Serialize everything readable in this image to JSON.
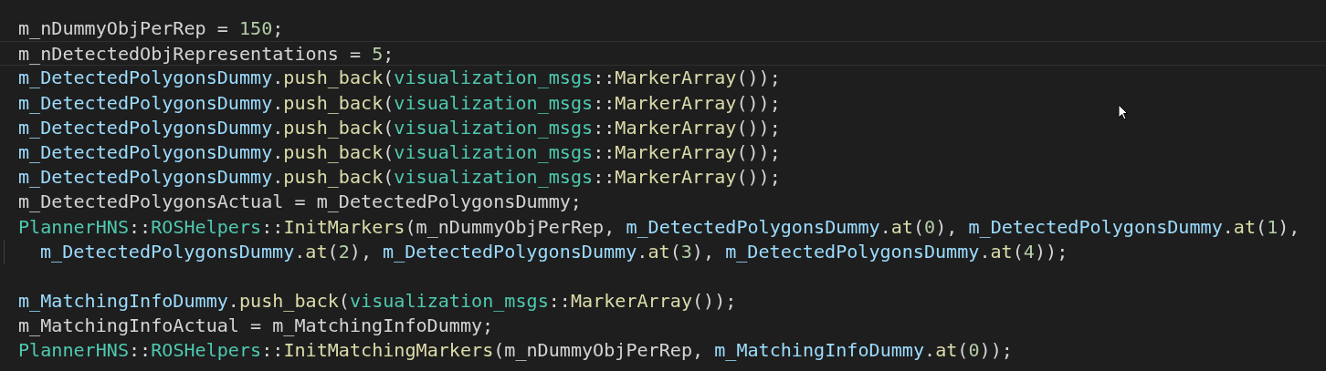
{
  "editor": {
    "lines": [
      {
        "kind": "code",
        "current": false,
        "tokens": [
          {
            "text": "m_nDummyObjPerRep = ",
            "kind": "plain"
          },
          {
            "text": "150",
            "kind": "number"
          },
          {
            "text": ";",
            "kind": "plain"
          }
        ]
      },
      {
        "kind": "code",
        "current": true,
        "tokens": [
          {
            "text": "m_nDetectedObjRepresentations = ",
            "kind": "plain"
          },
          {
            "text": "5",
            "kind": "number"
          },
          {
            "text": ";",
            "kind": "plain"
          }
        ]
      },
      {
        "kind": "code",
        "current": false,
        "tokens": [
          {
            "text": "m_DetectedPolygonsDummy",
            "kind": "variable"
          },
          {
            "text": ".",
            "kind": "plain"
          },
          {
            "text": "push_back",
            "kind": "function"
          },
          {
            "text": "(",
            "kind": "plain"
          },
          {
            "text": "visualization_msgs",
            "kind": "type"
          },
          {
            "text": "::",
            "kind": "plain"
          },
          {
            "text": "MarkerArray",
            "kind": "function"
          },
          {
            "text": "());",
            "kind": "plain"
          }
        ]
      },
      {
        "kind": "code",
        "current": false,
        "tokens": [
          {
            "text": "m_DetectedPolygonsDummy",
            "kind": "variable"
          },
          {
            "text": ".",
            "kind": "plain"
          },
          {
            "text": "push_back",
            "kind": "function"
          },
          {
            "text": "(",
            "kind": "plain"
          },
          {
            "text": "visualization_msgs",
            "kind": "type"
          },
          {
            "text": "::",
            "kind": "plain"
          },
          {
            "text": "MarkerArray",
            "kind": "function"
          },
          {
            "text": "());",
            "kind": "plain"
          }
        ]
      },
      {
        "kind": "code",
        "current": false,
        "tokens": [
          {
            "text": "m_DetectedPolygonsDummy",
            "kind": "variable"
          },
          {
            "text": ".",
            "kind": "plain"
          },
          {
            "text": "push_back",
            "kind": "function"
          },
          {
            "text": "(",
            "kind": "plain"
          },
          {
            "text": "visualization_msgs",
            "kind": "type"
          },
          {
            "text": "::",
            "kind": "plain"
          },
          {
            "text": "MarkerArray",
            "kind": "function"
          },
          {
            "text": "());",
            "kind": "plain"
          }
        ]
      },
      {
        "kind": "code",
        "current": false,
        "tokens": [
          {
            "text": "m_DetectedPolygonsDummy",
            "kind": "variable"
          },
          {
            "text": ".",
            "kind": "plain"
          },
          {
            "text": "push_back",
            "kind": "function"
          },
          {
            "text": "(",
            "kind": "plain"
          },
          {
            "text": "visualization_msgs",
            "kind": "type"
          },
          {
            "text": "::",
            "kind": "plain"
          },
          {
            "text": "MarkerArray",
            "kind": "function"
          },
          {
            "text": "());",
            "kind": "plain"
          }
        ]
      },
      {
        "kind": "code",
        "current": false,
        "tokens": [
          {
            "text": "m_DetectedPolygonsDummy",
            "kind": "variable"
          },
          {
            "text": ".",
            "kind": "plain"
          },
          {
            "text": "push_back",
            "kind": "function"
          },
          {
            "text": "(",
            "kind": "plain"
          },
          {
            "text": "visualization_msgs",
            "kind": "type"
          },
          {
            "text": "::",
            "kind": "plain"
          },
          {
            "text": "MarkerArray",
            "kind": "function"
          },
          {
            "text": "());",
            "kind": "plain"
          }
        ]
      },
      {
        "kind": "code",
        "current": false,
        "tokens": [
          {
            "text": "m_DetectedPolygonsActual = m_DetectedPolygonsDummy;",
            "kind": "plain"
          }
        ]
      },
      {
        "kind": "code",
        "current": false,
        "tokens": [
          {
            "text": "PlannerHNS",
            "kind": "type"
          },
          {
            "text": "::",
            "kind": "plain"
          },
          {
            "text": "ROSHelpers",
            "kind": "type"
          },
          {
            "text": "::",
            "kind": "plain"
          },
          {
            "text": "InitMarkers",
            "kind": "function"
          },
          {
            "text": "(m_nDummyObjPerRep, ",
            "kind": "plain"
          },
          {
            "text": "m_DetectedPolygonsDummy",
            "kind": "variable"
          },
          {
            "text": ".",
            "kind": "plain"
          },
          {
            "text": "at",
            "kind": "function"
          },
          {
            "text": "(",
            "kind": "plain"
          },
          {
            "text": "0",
            "kind": "number"
          },
          {
            "text": "), ",
            "kind": "plain"
          },
          {
            "text": "m_DetectedPolygonsDummy",
            "kind": "variable"
          },
          {
            "text": ".",
            "kind": "plain"
          },
          {
            "text": "at",
            "kind": "function"
          },
          {
            "text": "(",
            "kind": "plain"
          },
          {
            "text": "1",
            "kind": "number"
          },
          {
            "text": "),",
            "kind": "plain"
          }
        ]
      },
      {
        "kind": "continuation",
        "current": false,
        "tokens": [
          {
            "text": "m_DetectedPolygonsDummy",
            "kind": "variable"
          },
          {
            "text": ".",
            "kind": "plain"
          },
          {
            "text": "at",
            "kind": "function"
          },
          {
            "text": "(",
            "kind": "plain"
          },
          {
            "text": "2",
            "kind": "number"
          },
          {
            "text": "), ",
            "kind": "plain"
          },
          {
            "text": "m_DetectedPolygonsDummy",
            "kind": "variable"
          },
          {
            "text": ".",
            "kind": "plain"
          },
          {
            "text": "at",
            "kind": "function"
          },
          {
            "text": "(",
            "kind": "plain"
          },
          {
            "text": "3",
            "kind": "number"
          },
          {
            "text": "), ",
            "kind": "plain"
          },
          {
            "text": "m_DetectedPolygonsDummy",
            "kind": "variable"
          },
          {
            "text": ".",
            "kind": "plain"
          },
          {
            "text": "at",
            "kind": "function"
          },
          {
            "text": "(",
            "kind": "plain"
          },
          {
            "text": "4",
            "kind": "number"
          },
          {
            "text": "));",
            "kind": "plain"
          }
        ]
      },
      {
        "kind": "blank",
        "current": false
      },
      {
        "kind": "code",
        "current": false,
        "tokens": [
          {
            "text": "m_MatchingInfoDummy",
            "kind": "variable"
          },
          {
            "text": ".",
            "kind": "plain"
          },
          {
            "text": "push_back",
            "kind": "function"
          },
          {
            "text": "(",
            "kind": "plain"
          },
          {
            "text": "visualization_msgs",
            "kind": "type"
          },
          {
            "text": "::",
            "kind": "plain"
          },
          {
            "text": "MarkerArray",
            "kind": "function"
          },
          {
            "text": "());",
            "kind": "plain"
          }
        ]
      },
      {
        "kind": "code",
        "current": false,
        "tokens": [
          {
            "text": "m_MatchingInfoActual = m_MatchingInfoDummy;",
            "kind": "plain"
          }
        ]
      },
      {
        "kind": "code",
        "current": false,
        "tokens": [
          {
            "text": "PlannerHNS",
            "kind": "type"
          },
          {
            "text": "::",
            "kind": "plain"
          },
          {
            "text": "ROSHelpers",
            "kind": "type"
          },
          {
            "text": "::",
            "kind": "plain"
          },
          {
            "text": "InitMatchingMarkers",
            "kind": "function"
          },
          {
            "text": "(m_nDummyObjPerRep, ",
            "kind": "plain"
          },
          {
            "text": "m_MatchingInfoDummy",
            "kind": "variable"
          },
          {
            "text": ".",
            "kind": "plain"
          },
          {
            "text": "at",
            "kind": "function"
          },
          {
            "text": "(",
            "kind": "plain"
          },
          {
            "text": "0",
            "kind": "number"
          },
          {
            "text": "));",
            "kind": "plain"
          }
        ]
      }
    ]
  }
}
